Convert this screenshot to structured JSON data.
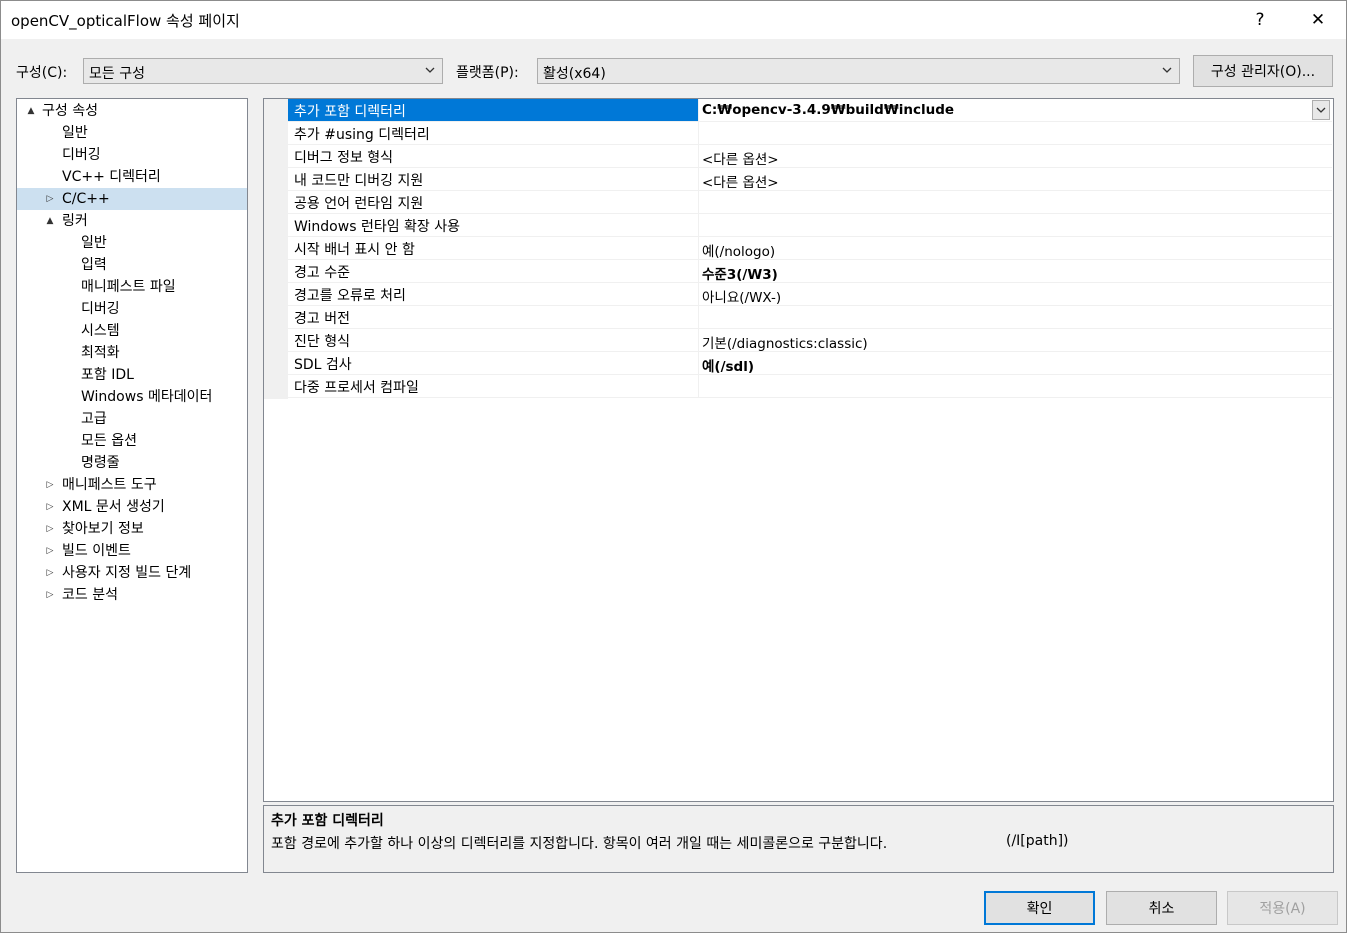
{
  "window": {
    "title": "openCV_opticalFlow 속성 페이지",
    "help": "?",
    "close": "✕"
  },
  "toolbar": {
    "config_label": "구성(C):",
    "config_value": "모든 구성",
    "platform_label": "플랫폼(P):",
    "platform_value": "활성(x64)",
    "config_manager": "구성 관리자(O)..."
  },
  "tree": {
    "items": [
      {
        "label": "구성 속성",
        "expander": "▲"
      },
      {
        "label": "일반"
      },
      {
        "label": "디버깅"
      },
      {
        "label": "VC++ 디렉터리"
      },
      {
        "label": "C/C++",
        "expander": "▷"
      },
      {
        "label": "링커",
        "expander": "▲"
      },
      {
        "label": "일반"
      },
      {
        "label": "입력"
      },
      {
        "label": "매니페스트 파일"
      },
      {
        "label": "디버깅"
      },
      {
        "label": "시스템"
      },
      {
        "label": "최적화"
      },
      {
        "label": "포함 IDL"
      },
      {
        "label": "Windows 메타데이터"
      },
      {
        "label": "고급"
      },
      {
        "label": "모든 옵션"
      },
      {
        "label": "명령줄"
      },
      {
        "label": "매니페스트 도구",
        "expander": "▷"
      },
      {
        "label": "XML 문서 생성기",
        "expander": "▷"
      },
      {
        "label": "찾아보기 정보",
        "expander": "▷"
      },
      {
        "label": "빌드 이벤트",
        "expander": "▷"
      },
      {
        "label": "사용자 지정 빌드 단계",
        "expander": "▷"
      },
      {
        "label": "코드 분석",
        "expander": "▷"
      }
    ]
  },
  "properties": {
    "rows": [
      {
        "name": "추가 포함 디렉터리",
        "value": "C:₩opencv-3.4.9₩build₩include"
      },
      {
        "name": "추가 #using 디렉터리",
        "value": ""
      },
      {
        "name": "디버그 정보 형식",
        "value": "<다른 옵션>"
      },
      {
        "name": "내 코드만 디버깅 지원",
        "value": "<다른 옵션>"
      },
      {
        "name": "공용 언어 런타임 지원",
        "value": ""
      },
      {
        "name": "Windows 런타임 확장 사용",
        "value": ""
      },
      {
        "name": "시작 배너 표시 안 함",
        "value": "예(/nologo)"
      },
      {
        "name": "경고 수준",
        "value": "수준3(/W3)"
      },
      {
        "name": "경고를 오류로 처리",
        "value": "아니요(/WX-)"
      },
      {
        "name": "경고 버전",
        "value": ""
      },
      {
        "name": "진단 형식",
        "value": "기본(/diagnostics:classic)"
      },
      {
        "name": "SDL 검사",
        "value": "예(/sdl)"
      },
      {
        "name": "다중 프로세서 컴파일",
        "value": ""
      }
    ]
  },
  "description": {
    "title": "추가 포함 디렉터리",
    "text": "포함 경로에 추가할 하나 이상의 디렉터리를 지정합니다. 항목이 여러 개일 때는 세미콜론으로 구분합니다.",
    "flag": "(/I[path])"
  },
  "buttons": {
    "ok": "확인",
    "cancel": "취소",
    "apply": "적용(A)"
  }
}
